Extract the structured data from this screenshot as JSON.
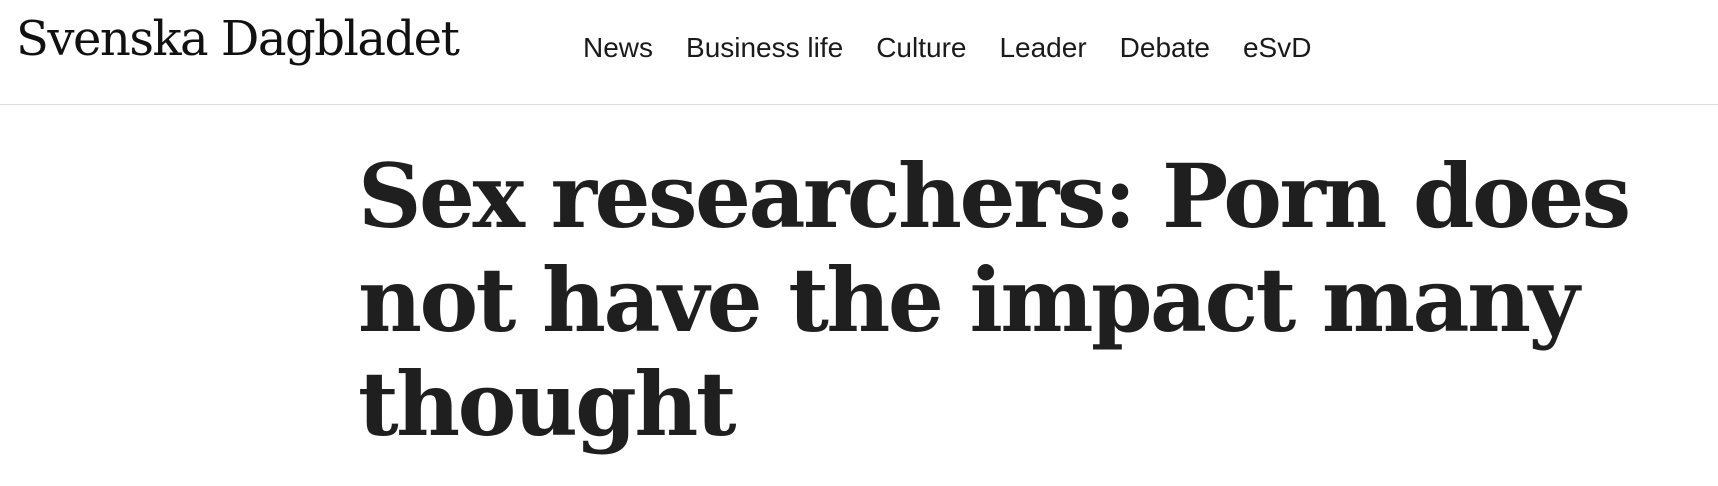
{
  "header": {
    "brand": "Svenska Dagbladet",
    "nav": [
      {
        "label": "News"
      },
      {
        "label": "Business life"
      },
      {
        "label": "Culture"
      },
      {
        "label": "Leader"
      },
      {
        "label": "Debate"
      },
      {
        "label": "eSvD"
      }
    ]
  },
  "article": {
    "headline": "Sex researchers: Porn does not have the impact many thought"
  },
  "colors": {
    "text": "#1f1f1f",
    "divider": "#dcdcdc",
    "background": "#ffffff"
  }
}
